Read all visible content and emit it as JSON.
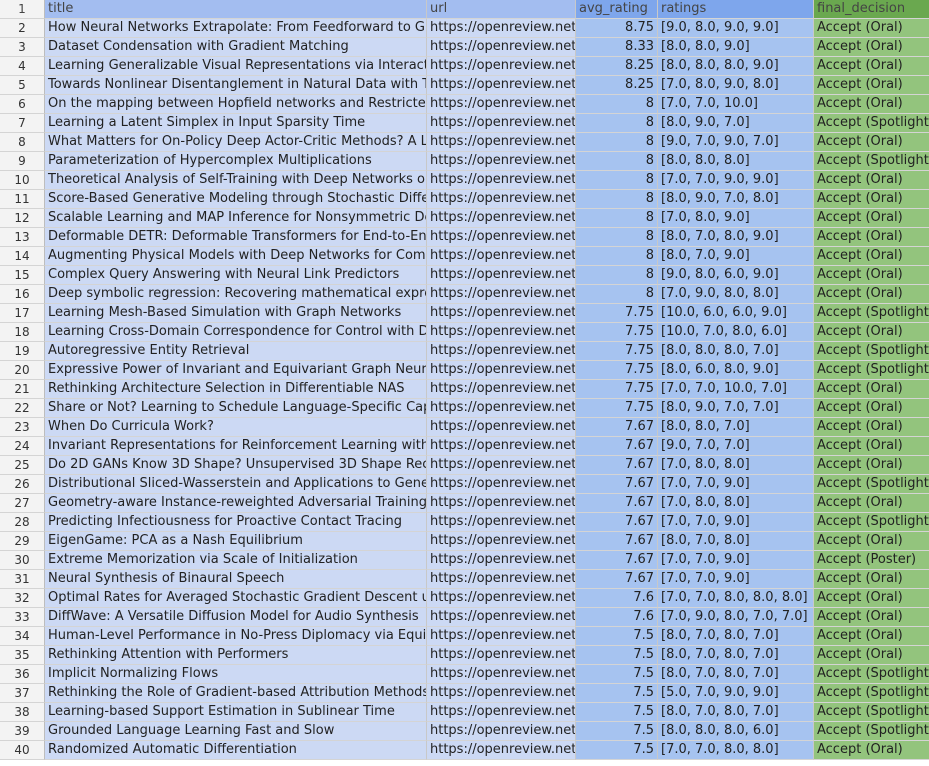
{
  "sheet": {
    "headers": {
      "title": "title",
      "url": "url",
      "avg_rating": "avg_rating",
      "ratings": "ratings",
      "final_decision": "final_decision"
    },
    "header_row_number": "1",
    "rows": [
      {
        "n": "2",
        "title": "How Neural Networks Extrapolate: From Feedforward to Graph",
        "url": "https://openreview.net/f",
        "avg": "8.75",
        "ratings": "[9.0, 8.0, 9.0, 9.0]",
        "decision": "Accept (Oral)"
      },
      {
        "n": "3",
        "title": "Dataset Condensation with Gradient Matching",
        "url": "https://openreview.net/f",
        "avg": "8.33",
        "ratings": "[8.0, 8.0, 9.0]",
        "decision": "Accept (Oral)"
      },
      {
        "n": "4",
        "title": "Learning Generalizable Visual Representations via Interactive Ga",
        "url": "https://openreview.net/f",
        "avg": "8.25",
        "ratings": "[8.0, 8.0, 8.0, 9.0]",
        "decision": "Accept (Oral)"
      },
      {
        "n": "5",
        "title": "Towards Nonlinear Disentanglement in Natural Data with Tempo",
        "url": "https://openreview.net/f",
        "avg": "8.25",
        "ratings": "[7.0, 8.0, 9.0, 8.0]",
        "decision": "Accept (Oral)"
      },
      {
        "n": "6",
        "title": "On the mapping between Hopfield networks and Restricted Bol",
        "url": "https://openreview.net/f",
        "avg": "8",
        "ratings": "[7.0, 7.0, 10.0]",
        "decision": "Accept (Oral)"
      },
      {
        "n": "7",
        "title": "Learning a Latent Simplex in Input Sparsity Time",
        "url": "https://openreview.net/f",
        "avg": "8",
        "ratings": "[8.0, 9.0, 7.0]",
        "decision": "Accept (Spotlight)"
      },
      {
        "n": "8",
        "title": "What Matters for On-Policy Deep Actor-Critic Methods? A Large",
        "url": "https://openreview.net/f",
        "avg": "8",
        "ratings": "[9.0, 7.0, 9.0, 7.0]",
        "decision": "Accept (Oral)"
      },
      {
        "n": "9",
        "title": "Parameterization of Hypercomplex Multiplications",
        "url": "https://openreview.net/f",
        "avg": "8",
        "ratings": "[8.0, 8.0, 8.0]",
        "decision": "Accept (Spotlight)"
      },
      {
        "n": "10",
        "title": "Theoretical Analysis of Self-Training with Deep Networks on Unl",
        "url": "https://openreview.net/f",
        "avg": "8",
        "ratings": "[7.0, 7.0, 9.0, 9.0]",
        "decision": "Accept (Oral)"
      },
      {
        "n": "11",
        "title": "Score-Based Generative Modeling through Stochastic Differentia",
        "url": "https://openreview.net/f",
        "avg": "8",
        "ratings": "[8.0, 9.0, 7.0, 8.0]",
        "decision": "Accept (Oral)"
      },
      {
        "n": "12",
        "title": "Scalable Learning and MAP Inference for Nonsymmetric Determ",
        "url": "https://openreview.net/f",
        "avg": "8",
        "ratings": "[7.0, 8.0, 9.0]",
        "decision": "Accept (Oral)"
      },
      {
        "n": "13",
        "title": "Deformable DETR: Deformable Transformers for End-to-End Obj",
        "url": "https://openreview.net/f",
        "avg": "8",
        "ratings": "[8.0, 7.0, 8.0, 9.0]",
        "decision": "Accept (Oral)"
      },
      {
        "n": "14",
        "title": "Augmenting Physical Models with Deep Networks for Complex D",
        "url": "https://openreview.net/f",
        "avg": "8",
        "ratings": "[8.0, 7.0, 9.0]",
        "decision": "Accept (Oral)"
      },
      {
        "n": "15",
        "title": "Complex Query Answering with Neural Link Predictors",
        "url": "https://openreview.net/f",
        "avg": "8",
        "ratings": "[9.0, 8.0, 6.0, 9.0]",
        "decision": "Accept (Oral)"
      },
      {
        "n": "16",
        "title": "Deep symbolic regression: Recovering mathematical expression",
        "url": "https://openreview.net/f",
        "avg": "8",
        "ratings": "[7.0, 9.0, 8.0, 8.0]",
        "decision": "Accept (Oral)"
      },
      {
        "n": "17",
        "title": "Learning Mesh-Based Simulation with Graph Networks",
        "url": "https://openreview.net/f",
        "avg": "7.75",
        "ratings": "[10.0, 6.0, 6.0, 9.0]",
        "decision": "Accept (Spotlight)"
      },
      {
        "n": "18",
        "title": "Learning Cross-Domain Correspondence for Control with Dynam",
        "url": "https://openreview.net/f",
        "avg": "7.75",
        "ratings": "[10.0, 7.0, 8.0, 6.0]",
        "decision": "Accept (Oral)"
      },
      {
        "n": "19",
        "title": "Autoregressive Entity Retrieval",
        "url": "https://openreview.net/f",
        "avg": "7.75",
        "ratings": "[8.0, 8.0, 8.0, 7.0]",
        "decision": "Accept (Spotlight)"
      },
      {
        "n": "20",
        "title": "Expressive Power of Invariant and Equivariant Graph Neural Net",
        "url": "https://openreview.net/f",
        "avg": "7.75",
        "ratings": "[8.0, 6.0, 8.0, 9.0]",
        "decision": "Accept (Spotlight)"
      },
      {
        "n": "21",
        "title": "Rethinking Architecture Selection in Differentiable NAS",
        "url": "https://openreview.net/f",
        "avg": "7.75",
        "ratings": "[7.0, 7.0, 10.0, 7.0]",
        "decision": "Accept (Oral)"
      },
      {
        "n": "22",
        "title": "Share or Not? Learning to Schedule Language-Specific Capacity",
        "url": "https://openreview.net/f",
        "avg": "7.75",
        "ratings": "[8.0, 9.0, 7.0, 7.0]",
        "decision": "Accept (Oral)"
      },
      {
        "n": "23",
        "title": "When Do Curricula Work?",
        "url": "https://openreview.net/f",
        "avg": "7.67",
        "ratings": "[8.0, 8.0, 7.0]",
        "decision": "Accept (Oral)"
      },
      {
        "n": "24",
        "title": "Invariant Representations for Reinforcement Learning without R",
        "url": "https://openreview.net/f",
        "avg": "7.67",
        "ratings": "[9.0, 7.0, 7.0]",
        "decision": "Accept (Oral)"
      },
      {
        "n": "25",
        "title": "Do 2D GANs Know 3D Shape? Unsupervised 3D Shape Reconstr",
        "url": "https://openreview.net/f",
        "avg": "7.67",
        "ratings": "[7.0, 8.0, 8.0]",
        "decision": "Accept (Oral)"
      },
      {
        "n": "26",
        "title": "Distributional Sliced-Wasserstein and Applications to Generative",
        "url": "https://openreview.net/f",
        "avg": "7.67",
        "ratings": "[7.0, 7.0, 9.0]",
        "decision": "Accept (Spotlight)"
      },
      {
        "n": "27",
        "title": "Geometry-aware Instance-reweighted Adversarial Training",
        "url": "https://openreview.net/f",
        "avg": "7.67",
        "ratings": "[7.0, 8.0, 8.0]",
        "decision": "Accept (Oral)"
      },
      {
        "n": "28",
        "title": "Predicting Infectiousness for Proactive Contact Tracing",
        "url": "https://openreview.net/f",
        "avg": "7.67",
        "ratings": "[7.0, 7.0, 9.0]",
        "decision": "Accept (Spotlight)"
      },
      {
        "n": "29",
        "title": "EigenGame: PCA as a Nash Equilibrium",
        "url": "https://openreview.net/f",
        "avg": "7.67",
        "ratings": "[8.0, 7.0, 8.0]",
        "decision": "Accept (Oral)"
      },
      {
        "n": "30",
        "title": "Extreme Memorization via Scale of Initialization",
        "url": "https://openreview.net/f",
        "avg": "7.67",
        "ratings": "[7.0, 7.0, 9.0]",
        "decision": "Accept (Poster)"
      },
      {
        "n": "31",
        "title": "Neural Synthesis of Binaural Speech",
        "url": "https://openreview.net/f",
        "avg": "7.67",
        "ratings": "[7.0, 7.0, 9.0]",
        "decision": "Accept (Oral)"
      },
      {
        "n": "32",
        "title": "Optimal Rates for Averaged Stochastic Gradient Descent under N",
        "url": "https://openreview.net/f",
        "avg": "7.6",
        "ratings": "[7.0, 7.0, 8.0, 8.0, 8.0]",
        "decision": "Accept (Oral)"
      },
      {
        "n": "33",
        "title": "DiffWave: A Versatile Diffusion Model for Audio Synthesis",
        "url": "https://openreview.net/f",
        "avg": "7.6",
        "ratings": "[7.0, 9.0, 8.0, 7.0, 7.0]",
        "decision": "Accept (Oral)"
      },
      {
        "n": "34",
        "title": "Human-Level Performance in No-Press Diplomacy via Equilibriu",
        "url": "https://openreview.net/f",
        "avg": "7.5",
        "ratings": "[8.0, 7.0, 8.0, 7.0]",
        "decision": "Accept (Oral)"
      },
      {
        "n": "35",
        "title": "Rethinking Attention with Performers",
        "url": "https://openreview.net/f",
        "avg": "7.5",
        "ratings": "[8.0, 7.0, 8.0, 7.0]",
        "decision": "Accept (Oral)"
      },
      {
        "n": "36",
        "title": "Implicit Normalizing Flows",
        "url": "https://openreview.net/f",
        "avg": "7.5",
        "ratings": "[8.0, 7.0, 8.0, 7.0]",
        "decision": "Accept (Spotlight)"
      },
      {
        "n": "37",
        "title": "Rethinking the Role of Gradient-based Attribution Methods for M",
        "url": "https://openreview.net/f",
        "avg": "7.5",
        "ratings": "[5.0, 7.0, 9.0, 9.0]",
        "decision": "Accept (Spotlight)"
      },
      {
        "n": "38",
        "title": "Learning-based Support Estimation in Sublinear Time",
        "url": "https://openreview.net/f",
        "avg": "7.5",
        "ratings": "[8.0, 7.0, 8.0, 7.0]",
        "decision": "Accept (Spotlight)"
      },
      {
        "n": "39",
        "title": "Grounded Language Learning Fast and Slow",
        "url": "https://openreview.net/f",
        "avg": "7.5",
        "ratings": "[8.0, 8.0, 8.0, 6.0]",
        "decision": "Accept (Spotlight)"
      },
      {
        "n": "40",
        "title": "Randomized Automatic Differentiation",
        "url": "https://openreview.net/f",
        "avg": "7.5",
        "ratings": "[7.0, 7.0, 8.0, 8.0]",
        "decision": "Accept (Oral)"
      }
    ]
  }
}
